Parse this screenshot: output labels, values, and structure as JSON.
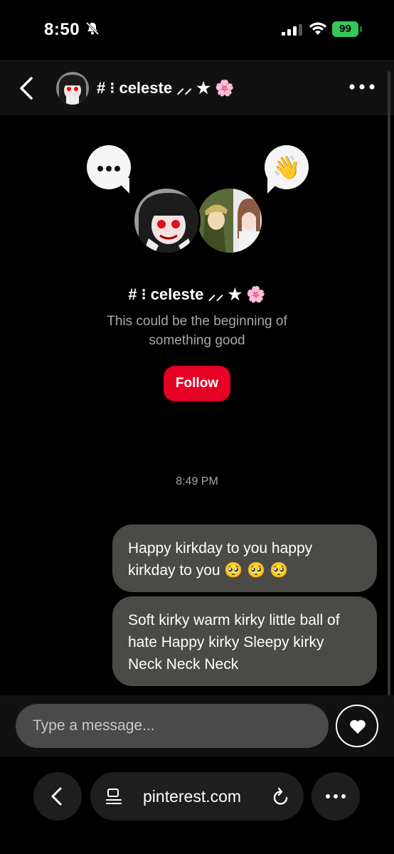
{
  "status_bar": {
    "time": "8:50",
    "battery": "99"
  },
  "header": {
    "name": "# ⁝ celeste ⸝⸝ ★ 🌸",
    "back_icon": "chevron-left-icon",
    "more_icon": "more-horizontal-icon"
  },
  "profile": {
    "name": "# ⁝ celeste ⸝⸝ ★ 🌸",
    "subtitle": "This could be the beginning of something good",
    "follow_label": "Follow",
    "left_bubble_icon": "typing-dots-icon",
    "right_bubble_icon": "👋"
  },
  "conversation": {
    "timestamp": "8:49 PM",
    "messages": [
      {
        "text": "Happy kirkday to you happy kirkday to you 🥺 🥺 🥺"
      },
      {
        "text": "Soft kirky warm kirky little ball of hate Happy kirky Sleepy kirky Neck Neck Neck"
      }
    ]
  },
  "composer": {
    "placeholder": "Type a message...",
    "like_icon": "heart-icon"
  },
  "browser": {
    "url": "pinterest.com",
    "back_icon": "chevron-left-icon",
    "menu_icon": "page-menu-icon",
    "reload_icon": "reload-icon",
    "more_icon": "more-horizontal-icon"
  },
  "colors": {
    "follow_button": "#e60023",
    "message_bubble": "#4a4b46",
    "battery": "#34c759"
  }
}
